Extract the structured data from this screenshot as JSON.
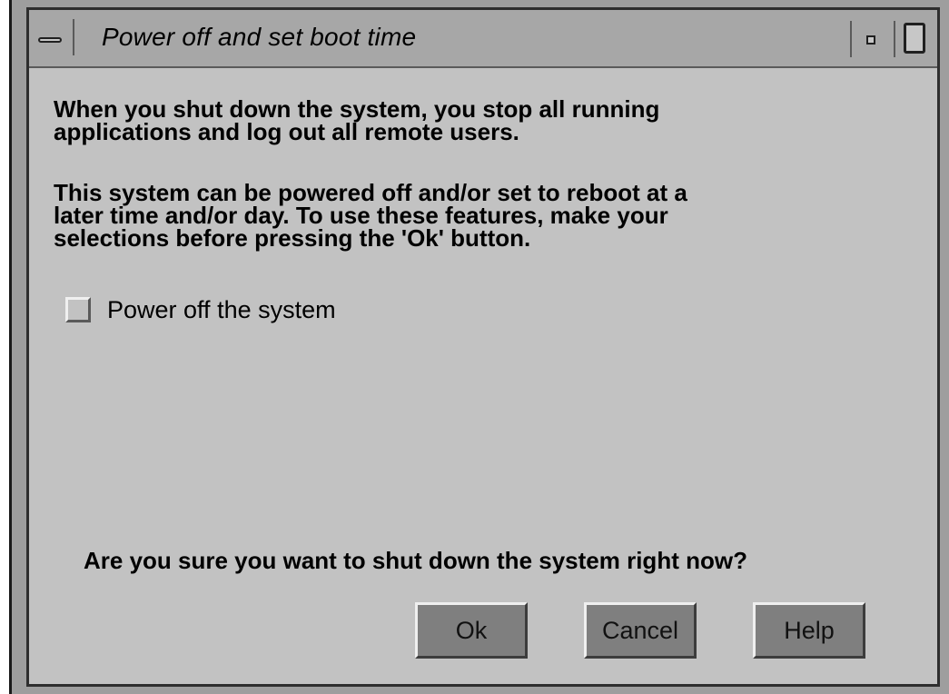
{
  "window": {
    "title": "Power off and set boot time"
  },
  "content": {
    "paragraph1": "When you shut down the system, you stop all running\napplications and log out all remote users.",
    "paragraph2": "This system can be powered off and/or set to reboot at a\nlater time and/or day. To use these features, make your\nselections before pressing the 'Ok' button.",
    "checkbox": {
      "label": "Power off the system",
      "checked": false
    },
    "question": "Are you sure you want to shut down the system right now?"
  },
  "buttons": {
    "ok_label": "Ok",
    "cancel_label": "Cancel",
    "help_label": "Help"
  },
  "icons": {
    "window_menu": "window-menu-icon",
    "minimize": "minimize-icon",
    "maximize": "maximize-icon"
  },
  "colors": {
    "window_bg": "#c2c2c2",
    "titlebar_bg": "#a7a7a7",
    "button_bg": "#7f7f7f"
  }
}
